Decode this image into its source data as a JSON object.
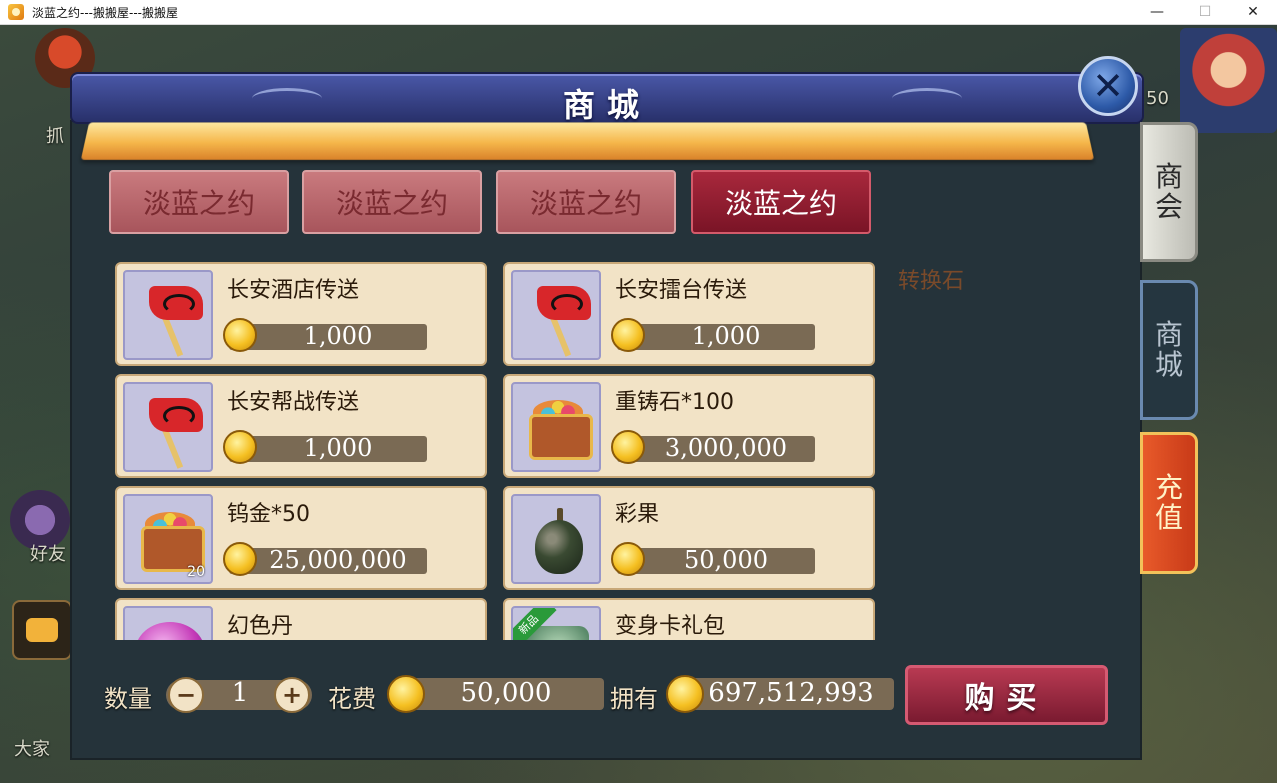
{
  "window": {
    "title": "淡蓝之约---搬搬屋---搬搬屋",
    "buttons": [
      "—",
      "☐",
      "✕"
    ]
  },
  "background": {
    "left_texts": [
      "抓",
      "好友",
      "大家"
    ],
    "top_right_number": "50"
  },
  "panel": {
    "title": "商城",
    "close_label": "✕"
  },
  "tabs": [
    {
      "label": "淡蓝之约",
      "active": false
    },
    {
      "label": "淡蓝之约",
      "active": false
    },
    {
      "label": "淡蓝之约",
      "active": false
    },
    {
      "label": "淡蓝之约",
      "active": true
    }
  ],
  "items": [
    {
      "name": "长安酒店传送",
      "price": "1,000",
      "icon": "flag-icon"
    },
    {
      "name": "长安擂台传送",
      "price": "1,000",
      "icon": "flag-icon"
    },
    {
      "name": "长安帮战传送",
      "price": "1,000",
      "icon": "flag-icon"
    },
    {
      "name": "重铸石*100",
      "price": "3,000,000",
      "icon": "treasure-chest-icon"
    },
    {
      "name": "钨金*50",
      "price": "25,000,000",
      "icon": "treasure-chest-icon",
      "count": "20"
    },
    {
      "name": "彩果",
      "price": "50,000",
      "icon": "fruit-icon"
    },
    {
      "name": "幻色丹",
      "icon": "pill-icon"
    },
    {
      "name": "变身卡礼包",
      "icon": "gift-pack-icon",
      "badge": "新品"
    }
  ],
  "info": {
    "selected_name": "转换石"
  },
  "side_tabs": [
    {
      "label": "商会",
      "chars": [
        "商",
        "会"
      ]
    },
    {
      "label": "商城",
      "chars": [
        "商",
        "城"
      ]
    },
    {
      "label": "充值",
      "chars": [
        "充",
        "值"
      ]
    }
  ],
  "purchase": {
    "quantity_label": "数量",
    "quantity": "1",
    "minus": "−",
    "plus": "+",
    "cost_label": "花费",
    "cost": "50,000",
    "owned_label": "拥有",
    "owned": "697,512,993",
    "buy_label": "购买"
  },
  "colors": {
    "header": "#2f3a80",
    "body": "#25333a",
    "tab_active": "#8a1a2e",
    "tab_inactive": "#b8656a",
    "item_card": "#f2e3c6",
    "price_bar": "#7a6a54",
    "coin": "#f5c022",
    "recharge": "#d8481f"
  }
}
